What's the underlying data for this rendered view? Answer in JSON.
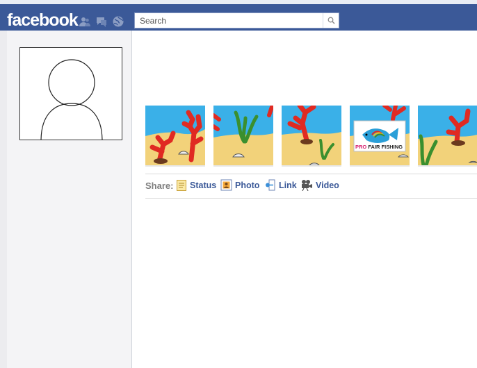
{
  "header": {
    "logo": "facebook",
    "search": {
      "placeholder": "Search",
      "value": ""
    },
    "jewels": [
      "friend-requests-icon",
      "messages-icon",
      "notifications-icon"
    ]
  },
  "sharebar": {
    "label": "Share:",
    "items": [
      {
        "label": "Status",
        "icon": "status-icon"
      },
      {
        "label": "Photo",
        "icon": "photo-icon"
      },
      {
        "label": "Link",
        "icon": "link-icon"
      },
      {
        "label": "Video",
        "icon": "video-icon"
      }
    ]
  },
  "photos": {
    "badge": {
      "pro": "PRO",
      "rest": "FAIR FISHING"
    }
  },
  "colors": {
    "brand": "#3b5998",
    "link": "#3b5998",
    "sky": "#3ab0e8",
    "sand": "#f2d27a",
    "coral": "#e02a22",
    "seaweed": "#3a8f2e"
  }
}
